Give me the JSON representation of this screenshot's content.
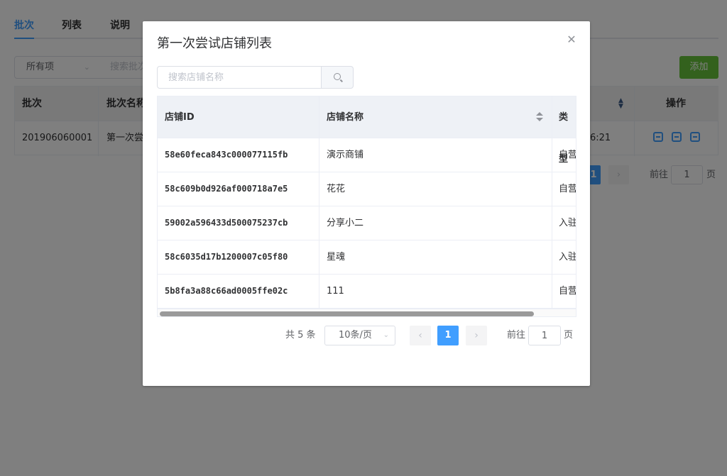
{
  "background": {
    "tabs": [
      {
        "label": "批次",
        "active": true
      },
      {
        "label": "列表",
        "active": false
      },
      {
        "label": "说明",
        "active": false
      }
    ],
    "filter": {
      "select_value": "所有项",
      "search_placeholder": "搜索批次"
    },
    "add_button": "添加",
    "table": {
      "headers": {
        "batch": "批次",
        "batch_name": "批次名称",
        "actions": "操作"
      },
      "row": {
        "batch": "201906060001",
        "batch_name": "第一次尝",
        "time_fragment": "6:21"
      }
    },
    "pagination": {
      "current_page": "1",
      "goto_label": "前往",
      "goto_value": "1",
      "goto_suffix": "页"
    }
  },
  "dialog": {
    "title": "第一次尝试店铺列表",
    "search_placeholder": "搜索店铺名称",
    "table": {
      "headers": {
        "shop_id": "店铺ID",
        "shop_name": "店铺名称",
        "type": "类型"
      },
      "rows": [
        {
          "shop_id": "58e60feca843c000077115fb",
          "shop_name": "演示商铺",
          "type": "自营"
        },
        {
          "shop_id": "58c609b0d926af000718a7e5",
          "shop_name": "花花",
          "type": "自营"
        },
        {
          "shop_id": "59002a596433d500075237cb",
          "shop_name": "分享小二",
          "type": "入驻"
        },
        {
          "shop_id": "58c6035d17b1200007c05f80",
          "shop_name": "星魂",
          "type": "入驻"
        },
        {
          "shop_id": "5b8fa3a88c66ad0005ffe02c",
          "shop_name": "111",
          "type": "自营"
        }
      ],
      "horizontal_scroll_fraction": 0.89
    },
    "pagination": {
      "total_text": "共 5 条",
      "page_size": "10条/页",
      "current_page": "1",
      "goto_label": "前往",
      "goto_value": "1",
      "goto_suffix": "页"
    }
  },
  "colors": {
    "primary": "#409eff",
    "success": "#67c23a",
    "overlay": "rgba(0,0,0,0.5)"
  },
  "icons": {
    "close": "close-icon",
    "search": "search-icon",
    "prev": "chevron-left-icon",
    "next": "chevron-right-icon",
    "dropdown": "chevron-down-icon",
    "sort": "sort-caret-icon"
  }
}
